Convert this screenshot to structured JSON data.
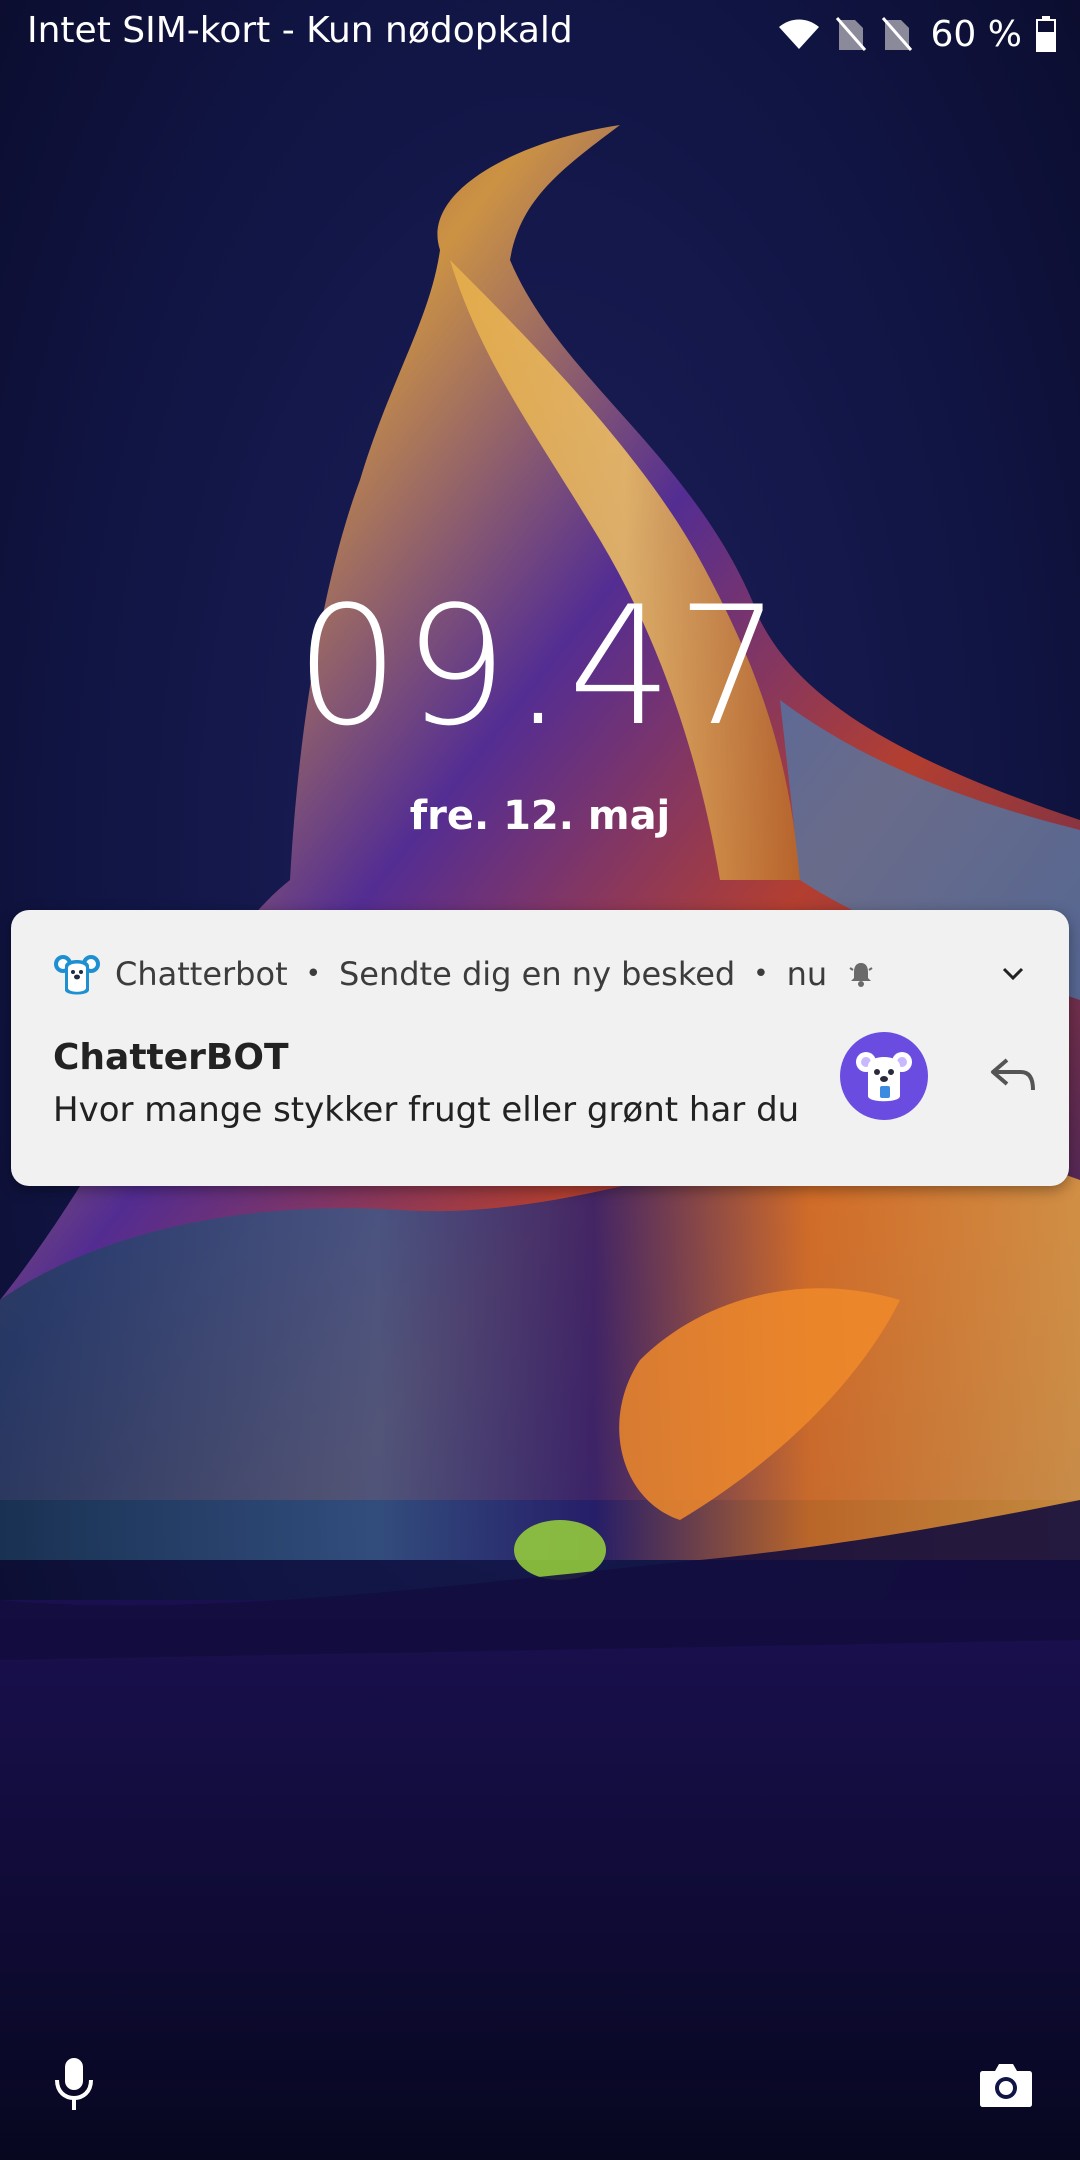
{
  "status_bar": {
    "carrier_text": "Intet SIM-kort - Kun nødopkald",
    "battery_percent": "60 %",
    "icons": [
      "wifi-icon",
      "no-sim-icon",
      "no-sim-icon",
      "battery-icon"
    ]
  },
  "lockscreen": {
    "time": "09.47",
    "date": "fre. 12. maj"
  },
  "notification": {
    "app_name": "Chatterbot",
    "subtext": "Sendte dig en ny besked",
    "time": "nu",
    "title": "ChatterBOT",
    "text": "Hvor mange stykker frugt eller grønt har du ..",
    "avatar_color": "#6a4de0",
    "icons": [
      "koala-app-icon",
      "bell-icon",
      "chevron-down-icon",
      "reply-icon"
    ]
  },
  "bottom": {
    "icons": [
      "microphone-icon",
      "camera-icon"
    ]
  },
  "colors": {
    "card_background": "#f1f1f2",
    "text_primary": "#222222",
    "wallpaper_base": "#0f1136"
  }
}
